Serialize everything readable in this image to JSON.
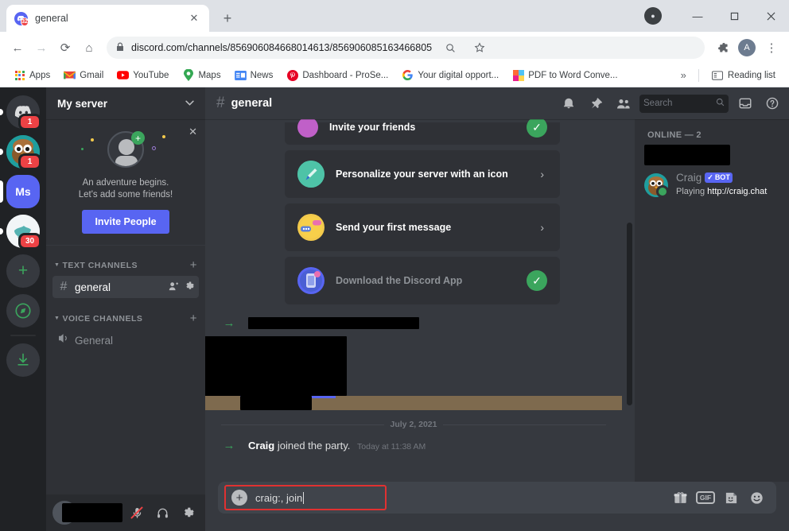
{
  "browser": {
    "tab": {
      "title": "general",
      "favicon_badge": "32",
      "close_label": "✕"
    },
    "newtab_label": "+",
    "window_controls": {
      "minimize": "—",
      "maximize": "❐",
      "close": "✕"
    },
    "nav": {
      "back": "←",
      "forward": "→",
      "reload": "⟳",
      "home": "⌂"
    },
    "omnibox": {
      "lock_icon": "lock-icon",
      "url": "discord.com/channels/856906084668014613/856906085163466805",
      "zoom_icon": "search-icon",
      "star_icon": "star-icon",
      "extensions_icon": "puzzle-icon",
      "profile_initial": "A",
      "menu_icon": "⋮"
    },
    "bookmarks": [
      {
        "label": "Apps",
        "icon": "apps-grid-icon"
      },
      {
        "label": "Gmail",
        "icon": "gmail-icon"
      },
      {
        "label": "YouTube",
        "icon": "youtube-icon"
      },
      {
        "label": "Maps",
        "icon": "maps-pin-icon"
      },
      {
        "label": "News",
        "icon": "google-news-icon"
      },
      {
        "label": "Dashboard - ProSe...",
        "icon": "pinterest-icon"
      },
      {
        "label": "Your digital opport...",
        "icon": "google-icon"
      },
      {
        "label": "PDF to Word Conve...",
        "icon": "colorful-square-icon"
      }
    ],
    "bookmarks_overflow": "»",
    "reading_list": {
      "label": "Reading list",
      "icon": "reading-list-icon"
    }
  },
  "discord": {
    "rail": [
      {
        "name": "discord-home",
        "type": "logo",
        "badge": "1",
        "color": "#36393f"
      },
      {
        "name": "owl-server",
        "type": "avatar",
        "badge": "1",
        "color": "#1f9e9e"
      },
      {
        "name": "ms-server",
        "type": "text",
        "label": "Ms",
        "selected": true,
        "color": "#5865f2"
      },
      {
        "name": "globe-server",
        "type": "avatar",
        "badge": "30",
        "color": "#e8ecef"
      },
      {
        "name": "add-server",
        "type": "icon",
        "glyph": "+",
        "color": "#36393f"
      },
      {
        "name": "explore-servers",
        "type": "icon",
        "glyph": "🧭",
        "color": "#36393f"
      },
      {
        "name": "download-apps",
        "type": "icon",
        "glyph": "↓",
        "color": "#36393f"
      }
    ],
    "sidebar": {
      "server_name": "My server",
      "chevron": "⌄",
      "promo": {
        "close": "✕",
        "line1": "An adventure begins.",
        "line2": "Let's add some friends!",
        "button": "Invite People"
      },
      "categories": [
        {
          "label": "TEXT CHANNELS",
          "add_label": "+",
          "channels": [
            {
              "name": "general",
              "prefix": "#",
              "active": true,
              "actions": [
                "add-member-icon",
                "gear-icon"
              ]
            }
          ]
        },
        {
          "label": "VOICE CHANNELS",
          "add_label": "+",
          "channels": [
            {
              "name": "General",
              "prefix": "🔊",
              "active": false,
              "actions": []
            }
          ]
        }
      ],
      "userbar": {
        "username_redacted": true,
        "icons": [
          "mic-muted-icon",
          "headphones-icon",
          "gear-icon"
        ]
      }
    },
    "channel_header": {
      "hash": "#",
      "title": "general",
      "icons": [
        "bell-icon",
        "pin-icon",
        "members-icon"
      ],
      "search_placeholder": "Search",
      "right_icons": [
        "inbox-icon",
        "help-icon"
      ]
    },
    "onboarding_cards": [
      {
        "label": "Invite your friends",
        "state": "done",
        "icon_color": "#c060c8",
        "icon": "envelope-icon",
        "partial": true
      },
      {
        "label": "Personalize your server with an icon",
        "state": "todo",
        "icon_color": "#3ba88f",
        "icon": "paintbrush-icon"
      },
      {
        "label": "Send your first message",
        "state": "todo",
        "icon_color": "#f2c94c",
        "icon": "chat-bubble-icon"
      },
      {
        "label": "Download the Discord App",
        "state": "done",
        "icon_color": "#5865f2",
        "icon": "phone-icon",
        "dim": true
      }
    ],
    "messages": [
      {
        "type": "system-redacted",
        "arrow": "→",
        "redact_width": 215
      },
      {
        "type": "embed-redacted"
      },
      {
        "type": "divider",
        "label": "July 2, 2021"
      },
      {
        "type": "system",
        "arrow": "→",
        "user": "Craig",
        "text": "joined the party.",
        "time": "Today at 11:38 AM"
      }
    ],
    "composer": {
      "plus": "+",
      "value": "craig:, join",
      "icons": [
        "gift-icon",
        "gif-icon",
        "sticker-icon",
        "emoji-icon"
      ],
      "gif_label": "GIF",
      "highlighted": true,
      "highlight_color": "#e03131"
    },
    "members": {
      "category": "ONLINE — 2",
      "redacted_member": true,
      "list": [
        {
          "name": "Craig",
          "bot_tag": "BOT",
          "bot_check": "✓",
          "status_text_prefix": "Playing ",
          "status_link": "http://craig.chat",
          "avatar_color": "#1f9e9e",
          "online": true
        }
      ]
    }
  },
  "colors": {
    "accent": "#5865f2",
    "online": "#3ba55d",
    "danger": "#ed4245",
    "chat_bg": "#36393f",
    "sidebar_bg": "#2f3136",
    "rail_bg": "#202225"
  }
}
